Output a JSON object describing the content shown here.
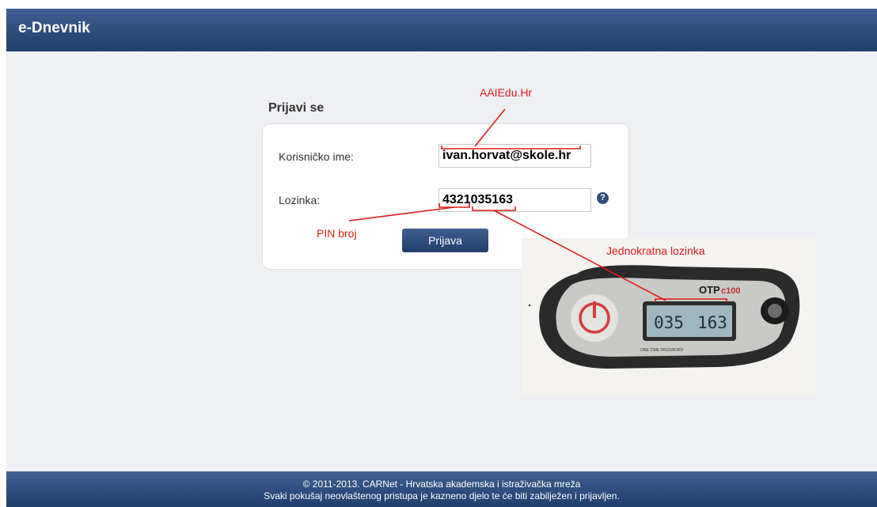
{
  "app": {
    "title": "e-Dnevnik"
  },
  "login": {
    "title": "Prijavi se",
    "username_label": "Korisničko ime:",
    "username_value": "ivan.horvat@skole.hr",
    "password_label": "Lozinka:",
    "password_value": "4321035163",
    "help_glyph": "?",
    "button_label": "Prijava"
  },
  "annotations": {
    "domain_label": "AAIEdu.Hr",
    "pin_label": "PIN broj",
    "otp_label": "Jednokratna lozinka"
  },
  "token": {
    "brand": "OTP",
    "model": "c100",
    "display_digits_1": "035",
    "display_digits_2": "163",
    "caption": "ONE TIME PASSWORD"
  },
  "footer": {
    "line1": "© 2011-2013. CARNet - Hrvatska akademska i istraživačka mreža",
    "line2": "Svaki pokušaj neovlaštenog pristupa je kazneno djelo te će biti zabilježen i prijavljen."
  },
  "colors": {
    "header": "#2e4f7e",
    "annotation": "#e01b1b",
    "page_bg": "#eef0f3"
  }
}
